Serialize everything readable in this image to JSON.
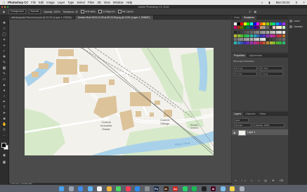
{
  "menubar": {
    "app": "Photoshop CC",
    "items": [
      "File",
      "Edit",
      "Image",
      "Layer",
      "Type",
      "Select",
      "Filter",
      "3D",
      "View",
      "Window",
      "Help"
    ],
    "status_right": "Mon 03:24"
  },
  "titlebar": {
    "title": "Adobe Photoshop CC 2018"
  },
  "options": {
    "mode": "Foreground",
    "mode2": "Normal",
    "opacity_label": "Opacity: 100%",
    "tolerance_label": "Tolerance: 32",
    "antialias": "Anti-alias",
    "contiguous": "Contiguous",
    "all_layers": "All Layers"
  },
  "tabs": [
    {
      "label": "afterkasparks Recovered.psd @ 33.3% (Layer 1, RGB/8)",
      "active": false
    },
    {
      "label": "Screen Shot 2019-12-09 at 09.23.00.png @ 113% (Layer 1, RGB/8*)",
      "active": true
    }
  ],
  "status": {
    "text": "113%   Doc: 4.51M/8.46M"
  },
  "map": {
    "labels": {
      "estate1": "Cuseck",
      "estate2": "Industrial",
      "estate3": "Estate",
      "depot1": "Cuseck",
      "depot2": "Sidings",
      "junction1": "Reclam",
      "junction2": "Junction",
      "river": "River Trent"
    }
  },
  "panels": {
    "color_tabs": [
      "Color",
      "Swatches"
    ],
    "props_tabs": [
      "Properties",
      "Adjustments"
    ],
    "props_title": "Pixel Layer Properties",
    "props_fields": [
      "W: 0 px",
      "H: 0 px",
      "X: 0 px",
      "Y: 0 px"
    ],
    "layers_tabs": [
      "Layers",
      "Channels",
      "Paths"
    ],
    "layer_kind": "Kind",
    "layer_mode": "Normal",
    "layer_opacity": "Opacity: 100%",
    "layer_name": "Layer 1"
  },
  "sidebar": [
    {
      "icon": "learn-icon",
      "label": "Learn"
    },
    {
      "icon": "libraries-icon",
      "label": "Libraries"
    }
  ],
  "swatch_colors": [
    "#ffffff",
    "#000000",
    "#ff0000",
    "#ffff00",
    "#00ff00",
    "#00ffff",
    "#0000ff",
    "#ff00ff",
    "#ff6600",
    "#ffcc00",
    "#99cc00",
    "#33cc33",
    "#00cc99",
    "#0099ff",
    "#3333ff",
    "#9933ff",
    "#cc0066",
    "#993300",
    "#666600",
    "#006600",
    "#006666",
    "#003399",
    "#330099",
    "#660066",
    "#cc9966",
    "#999999",
    "#666666",
    "#333333",
    "#ffcccc",
    "#ffe5cc",
    "#ffffcc",
    "#ccffcc"
  ],
  "dock_apps": [
    "Finder",
    "Launchpad",
    "Safari",
    "Mail",
    "Calendar",
    "Photos",
    "Messages",
    "Music",
    "App Store",
    "Settings",
    "Photoshop",
    "Illustrator",
    "Acrobat",
    "WhatsApp",
    "Spotify",
    "Terminal",
    "InDesign",
    "Preview",
    "Notes",
    "Trash"
  ]
}
